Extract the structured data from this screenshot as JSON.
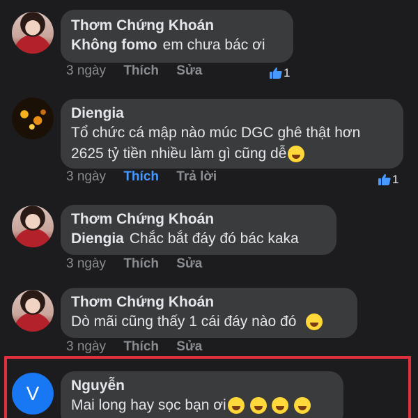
{
  "comments": [
    {
      "author": "Thơm Chứng Khoán",
      "mention": "Không fomo",
      "text": "em chưa bác ơi",
      "time": "3 ngày",
      "actions": [
        "Thích",
        "Sửa"
      ],
      "reaction_count": "1"
    },
    {
      "author": "Diengia",
      "text_line1": "Tổ chức cá mập nào múc DGC ghê  thật hơn",
      "text_line2": "2625 tỷ tiền nhiều làm gì cũng dễ",
      "time": "3 ngày",
      "actions": [
        "Thích",
        "Trả lời"
      ],
      "reaction_count": "1"
    },
    {
      "author": "Thơm Chứng Khoán",
      "mention": "Diengia",
      "text": "Chắc bắt đáy đó bác kaka",
      "time": "3 ngày",
      "actions": [
        "Thích",
        "Sửa"
      ]
    },
    {
      "author": "Thơm Chứng Khoán",
      "text": "Dò mãi cũng thấy 1 cái đáy nào đó",
      "time": "3 ngày",
      "actions": [
        "Thích",
        "Sửa"
      ]
    },
    {
      "author": "Nguyễn",
      "avatar_letter": "V",
      "text": "Mai long hay sọc bạn ơi"
    }
  ],
  "icons": {
    "like": "thumbs-up-icon",
    "laugh": "rofl-emoji-icon",
    "grin": "grin-emoji-icon"
  },
  "colors": {
    "background": "#1c1c1e",
    "bubble": "#3a3b3c",
    "accent": "#4599ff",
    "highlight": "#e0303b"
  }
}
